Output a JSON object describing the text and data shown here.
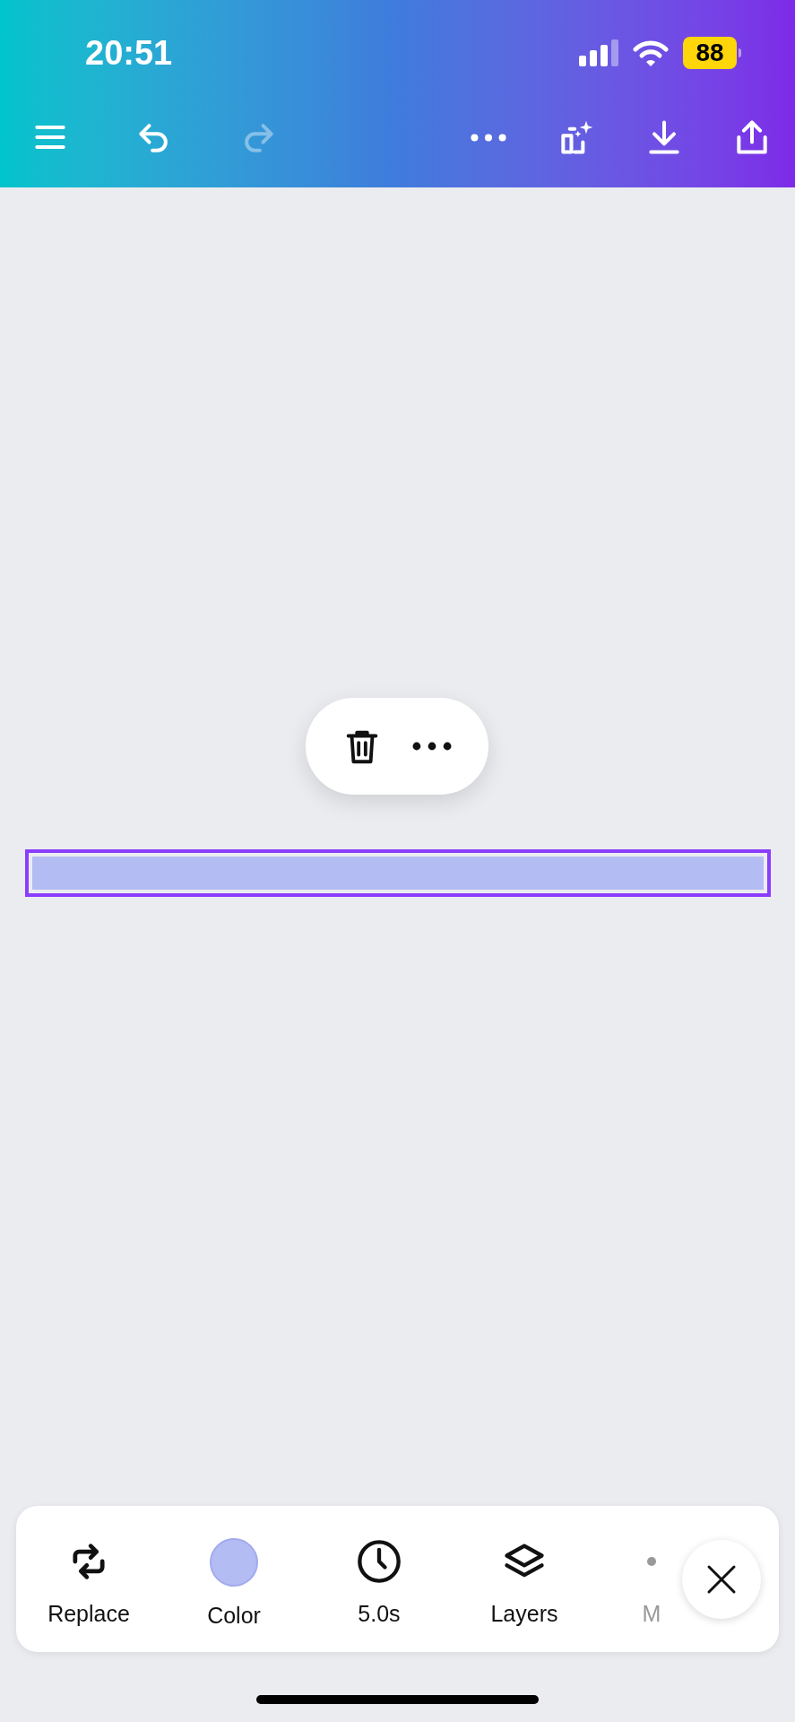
{
  "status_bar": {
    "time": "20:51",
    "battery": "88"
  },
  "top_toolbar": [
    {
      "kind": "menu",
      "disabled": false
    },
    {
      "kind": "undo",
      "disabled": false
    },
    {
      "kind": "redo",
      "disabled": true
    },
    {
      "kind": "more",
      "disabled": false
    },
    {
      "kind": "magic",
      "disabled": false
    },
    {
      "kind": "download",
      "disabled": false
    },
    {
      "kind": "share",
      "disabled": false
    }
  ],
  "context_menu": [
    {
      "kind": "delete"
    },
    {
      "kind": "more"
    }
  ],
  "design_element": {
    "selected": true
  },
  "bottom_toolbar": [
    {
      "kind": "replace",
      "label": "Replace"
    },
    {
      "kind": "color",
      "label": "Color"
    },
    {
      "kind": "duration",
      "label": "5.0s"
    },
    {
      "kind": "layers",
      "label": "Layers"
    },
    {
      "kind": "more",
      "label": "M"
    }
  ]
}
